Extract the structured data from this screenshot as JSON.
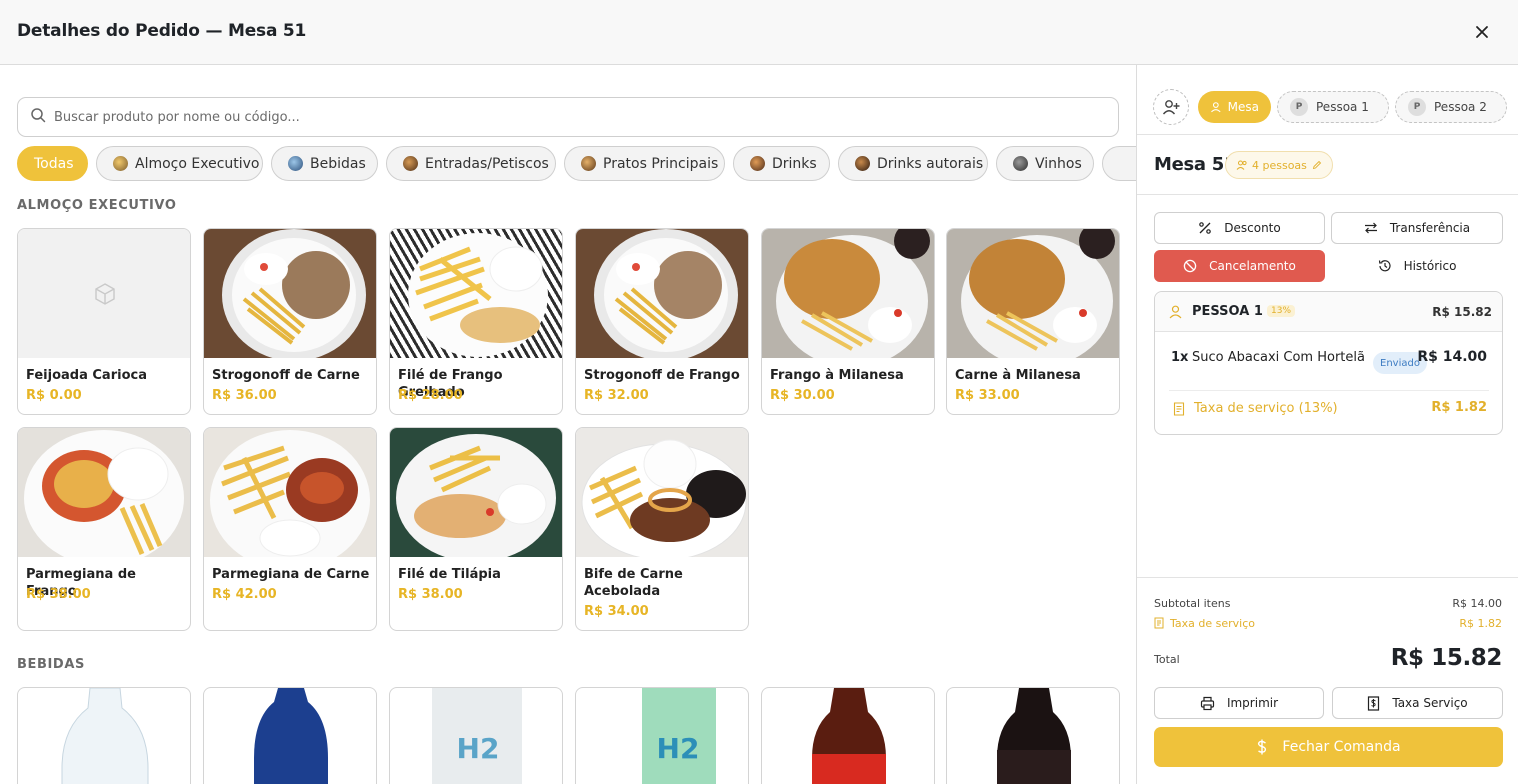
{
  "header": {
    "title": "Detalhes do Pedido — Mesa 51"
  },
  "search": {
    "placeholder": "Buscar produto por nome ou código..."
  },
  "categories": [
    {
      "label": "Todas"
    },
    {
      "label": "Almoço Executivo"
    },
    {
      "label": "Bebidas"
    },
    {
      "label": "Entradas/Petiscos"
    },
    {
      "label": "Pratos Principais"
    },
    {
      "label": "Drinks"
    },
    {
      "label": "Drinks autorais"
    },
    {
      "label": "Vinhos"
    }
  ],
  "sections": {
    "almoco": {
      "title": "ALMOÇO EXECUTIVO",
      "products": [
        {
          "name": "Feijoada Carioca",
          "price": "R$ 0.00"
        },
        {
          "name": "Strogonoff de Carne",
          "price": "R$ 36.00"
        },
        {
          "name": "Filé de Frango Grelhado",
          "price": "R$ 28.00"
        },
        {
          "name": "Strogonoff de Frango",
          "price": "R$ 32.00"
        },
        {
          "name": "Frango à Milanesa",
          "price": "R$ 30.00"
        },
        {
          "name": "Carne à Milanesa",
          "price": "R$ 33.00"
        },
        {
          "name": "Parmegiana de Frango",
          "price": "R$ 38.00"
        },
        {
          "name": "Parmegiana de Carne",
          "price": "R$ 42.00"
        },
        {
          "name": "Filé de Tilápia",
          "price": "R$ 38.00"
        },
        {
          "name": "Bife de Carne Acebolada",
          "price": "R$ 34.00"
        }
      ]
    },
    "bebidas": {
      "title": "BEBIDAS"
    }
  },
  "order": {
    "tabs": [
      {
        "label": "Mesa"
      },
      {
        "label": "Pessoa 1",
        "avatar": "P"
      },
      {
        "label": "Pessoa 2",
        "avatar": "P"
      }
    ],
    "table_title": "Mesa 51",
    "people": "4 pessoas",
    "actions": {
      "discount": "Desconto",
      "transfer": "Transferência",
      "cancel": "Cancelamento",
      "history": "Histórico"
    },
    "person": {
      "name": "PESSOA 1",
      "service_pct": "13%",
      "total": "R$ 15.82",
      "item": {
        "qty": "1x",
        "name": "Suco Abacaxi Com Hortelã",
        "status": "Enviado",
        "price": "R$ 14.00"
      },
      "service_label": "Taxa de serviço (13%)",
      "service_value": "R$ 1.82"
    },
    "summary": {
      "subtotal_label": "Subtotal itens",
      "subtotal_value": "R$ 14.00",
      "service_label": "Taxa de serviço",
      "service_value": "R$ 1.82",
      "total_label": "Total",
      "total_value": "R$ 15.82"
    },
    "buttons": {
      "print": "Imprimir",
      "service_fee": "Taxa Serviço",
      "close": "Fechar Comanda"
    }
  },
  "colors": {
    "accent": "#efc23b",
    "danger": "#e05a4f",
    "price": "#e7b526",
    "badge_blue": "#3e7cc2"
  }
}
